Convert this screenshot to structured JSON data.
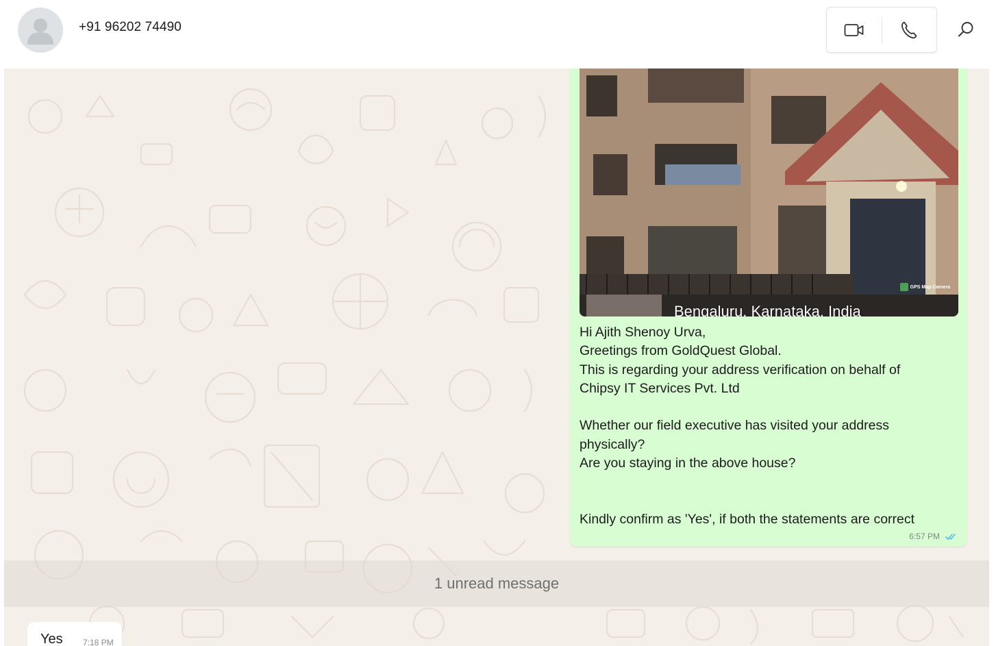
{
  "header": {
    "contact_name": "+91 96202 74490",
    "video_call_icon": "video-camera-icon",
    "voice_call_icon": "phone-icon",
    "search_icon": "search-icon",
    "avatar_icon": "default-person-avatar"
  },
  "messages": {
    "outgoing": {
      "image_caption": "Bengaluru, Karnataka, India",
      "image_badge": "GPS Map Camera",
      "text_lines": [
        "Hi Ajith Shenoy Urva,",
        "Greetings from GoldQuest Global.",
        "This is regarding your address verification on behalf of",
        "Chipsy IT Services Pvt. Ltd",
        "",
        "Whether our field executive has visited your address",
        "physically?",
        "Are you staying in the above house?",
        "",
        "",
        "Kindly confirm as 'Yes', if both the statements are correct"
      ],
      "time": "6:57 PM",
      "status_icon": "double-check-read-icon"
    },
    "unread_banner": "1 unread message",
    "incoming": {
      "text": "Yes",
      "time": "7:18 PM"
    }
  },
  "colors": {
    "outgoing_bubble": "#d9fdd3",
    "chat_background": "#f4efe9",
    "read_ticks": "#53bdeb"
  }
}
